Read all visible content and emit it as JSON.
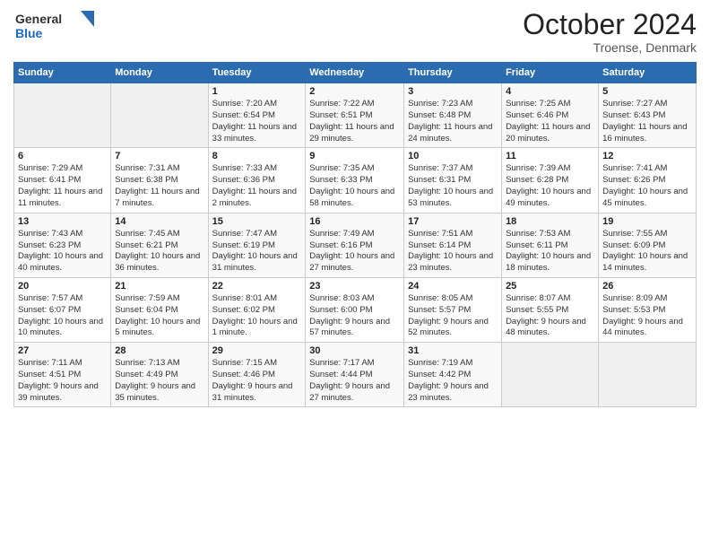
{
  "logo": {
    "general": "General",
    "blue": "Blue"
  },
  "header": {
    "title": "October 2024",
    "location": "Troense, Denmark"
  },
  "weekdays": [
    "Sunday",
    "Monday",
    "Tuesday",
    "Wednesday",
    "Thursday",
    "Friday",
    "Saturday"
  ],
  "weeks": [
    [
      {
        "day": "",
        "sunrise": "",
        "sunset": "",
        "daylight": ""
      },
      {
        "day": "",
        "sunrise": "",
        "sunset": "",
        "daylight": ""
      },
      {
        "day": "1",
        "sunrise": "Sunrise: 7:20 AM",
        "sunset": "Sunset: 6:54 PM",
        "daylight": "Daylight: 11 hours and 33 minutes."
      },
      {
        "day": "2",
        "sunrise": "Sunrise: 7:22 AM",
        "sunset": "Sunset: 6:51 PM",
        "daylight": "Daylight: 11 hours and 29 minutes."
      },
      {
        "day": "3",
        "sunrise": "Sunrise: 7:23 AM",
        "sunset": "Sunset: 6:48 PM",
        "daylight": "Daylight: 11 hours and 24 minutes."
      },
      {
        "day": "4",
        "sunrise": "Sunrise: 7:25 AM",
        "sunset": "Sunset: 6:46 PM",
        "daylight": "Daylight: 11 hours and 20 minutes."
      },
      {
        "day": "5",
        "sunrise": "Sunrise: 7:27 AM",
        "sunset": "Sunset: 6:43 PM",
        "daylight": "Daylight: 11 hours and 16 minutes."
      }
    ],
    [
      {
        "day": "6",
        "sunrise": "Sunrise: 7:29 AM",
        "sunset": "Sunset: 6:41 PM",
        "daylight": "Daylight: 11 hours and 11 minutes."
      },
      {
        "day": "7",
        "sunrise": "Sunrise: 7:31 AM",
        "sunset": "Sunset: 6:38 PM",
        "daylight": "Daylight: 11 hours and 7 minutes."
      },
      {
        "day": "8",
        "sunrise": "Sunrise: 7:33 AM",
        "sunset": "Sunset: 6:36 PM",
        "daylight": "Daylight: 11 hours and 2 minutes."
      },
      {
        "day": "9",
        "sunrise": "Sunrise: 7:35 AM",
        "sunset": "Sunset: 6:33 PM",
        "daylight": "Daylight: 10 hours and 58 minutes."
      },
      {
        "day": "10",
        "sunrise": "Sunrise: 7:37 AM",
        "sunset": "Sunset: 6:31 PM",
        "daylight": "Daylight: 10 hours and 53 minutes."
      },
      {
        "day": "11",
        "sunrise": "Sunrise: 7:39 AM",
        "sunset": "Sunset: 6:28 PM",
        "daylight": "Daylight: 10 hours and 49 minutes."
      },
      {
        "day": "12",
        "sunrise": "Sunrise: 7:41 AM",
        "sunset": "Sunset: 6:26 PM",
        "daylight": "Daylight: 10 hours and 45 minutes."
      }
    ],
    [
      {
        "day": "13",
        "sunrise": "Sunrise: 7:43 AM",
        "sunset": "Sunset: 6:23 PM",
        "daylight": "Daylight: 10 hours and 40 minutes."
      },
      {
        "day": "14",
        "sunrise": "Sunrise: 7:45 AM",
        "sunset": "Sunset: 6:21 PM",
        "daylight": "Daylight: 10 hours and 36 minutes."
      },
      {
        "day": "15",
        "sunrise": "Sunrise: 7:47 AM",
        "sunset": "Sunset: 6:19 PM",
        "daylight": "Daylight: 10 hours and 31 minutes."
      },
      {
        "day": "16",
        "sunrise": "Sunrise: 7:49 AM",
        "sunset": "Sunset: 6:16 PM",
        "daylight": "Daylight: 10 hours and 27 minutes."
      },
      {
        "day": "17",
        "sunrise": "Sunrise: 7:51 AM",
        "sunset": "Sunset: 6:14 PM",
        "daylight": "Daylight: 10 hours and 23 minutes."
      },
      {
        "day": "18",
        "sunrise": "Sunrise: 7:53 AM",
        "sunset": "Sunset: 6:11 PM",
        "daylight": "Daylight: 10 hours and 18 minutes."
      },
      {
        "day": "19",
        "sunrise": "Sunrise: 7:55 AM",
        "sunset": "Sunset: 6:09 PM",
        "daylight": "Daylight: 10 hours and 14 minutes."
      }
    ],
    [
      {
        "day": "20",
        "sunrise": "Sunrise: 7:57 AM",
        "sunset": "Sunset: 6:07 PM",
        "daylight": "Daylight: 10 hours and 10 minutes."
      },
      {
        "day": "21",
        "sunrise": "Sunrise: 7:59 AM",
        "sunset": "Sunset: 6:04 PM",
        "daylight": "Daylight: 10 hours and 5 minutes."
      },
      {
        "day": "22",
        "sunrise": "Sunrise: 8:01 AM",
        "sunset": "Sunset: 6:02 PM",
        "daylight": "Daylight: 10 hours and 1 minute."
      },
      {
        "day": "23",
        "sunrise": "Sunrise: 8:03 AM",
        "sunset": "Sunset: 6:00 PM",
        "daylight": "Daylight: 9 hours and 57 minutes."
      },
      {
        "day": "24",
        "sunrise": "Sunrise: 8:05 AM",
        "sunset": "Sunset: 5:57 PM",
        "daylight": "Daylight: 9 hours and 52 minutes."
      },
      {
        "day": "25",
        "sunrise": "Sunrise: 8:07 AM",
        "sunset": "Sunset: 5:55 PM",
        "daylight": "Daylight: 9 hours and 48 minutes."
      },
      {
        "day": "26",
        "sunrise": "Sunrise: 8:09 AM",
        "sunset": "Sunset: 5:53 PM",
        "daylight": "Daylight: 9 hours and 44 minutes."
      }
    ],
    [
      {
        "day": "27",
        "sunrise": "Sunrise: 7:11 AM",
        "sunset": "Sunset: 4:51 PM",
        "daylight": "Daylight: 9 hours and 39 minutes."
      },
      {
        "day": "28",
        "sunrise": "Sunrise: 7:13 AM",
        "sunset": "Sunset: 4:49 PM",
        "daylight": "Daylight: 9 hours and 35 minutes."
      },
      {
        "day": "29",
        "sunrise": "Sunrise: 7:15 AM",
        "sunset": "Sunset: 4:46 PM",
        "daylight": "Daylight: 9 hours and 31 minutes."
      },
      {
        "day": "30",
        "sunrise": "Sunrise: 7:17 AM",
        "sunset": "Sunset: 4:44 PM",
        "daylight": "Daylight: 9 hours and 27 minutes."
      },
      {
        "day": "31",
        "sunrise": "Sunrise: 7:19 AM",
        "sunset": "Sunset: 4:42 PM",
        "daylight": "Daylight: 9 hours and 23 minutes."
      },
      {
        "day": "",
        "sunrise": "",
        "sunset": "",
        "daylight": ""
      },
      {
        "day": "",
        "sunrise": "",
        "sunset": "",
        "daylight": ""
      }
    ]
  ]
}
